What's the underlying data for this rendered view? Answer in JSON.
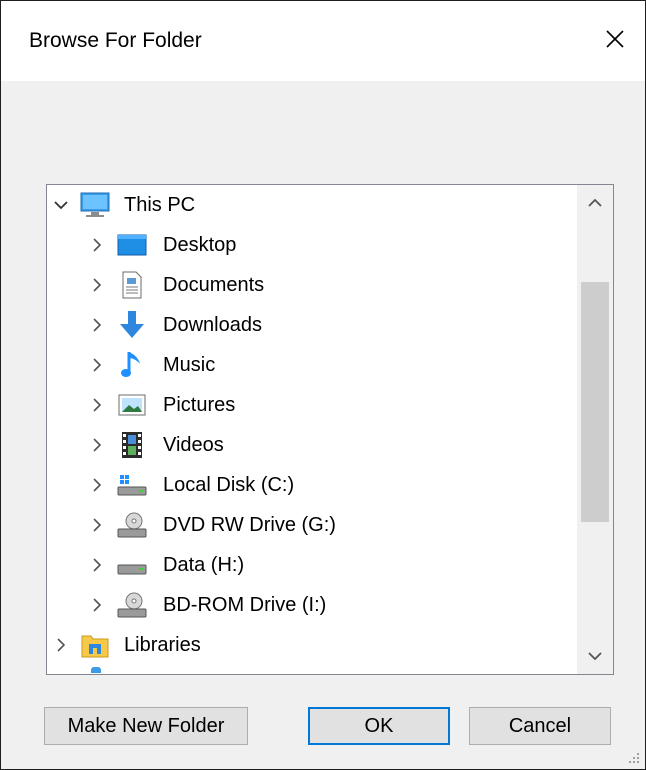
{
  "window": {
    "title": "Browse For Folder",
    "close_glyph": "✕"
  },
  "tree": {
    "items": [
      {
        "label": "This PC",
        "icon": "computer-icon",
        "expanded": true,
        "level": 0
      },
      {
        "label": "Desktop",
        "icon": "desktop-icon",
        "level": 1
      },
      {
        "label": "Documents",
        "icon": "documents-icon",
        "level": 1
      },
      {
        "label": "Downloads",
        "icon": "downloads-icon",
        "level": 1
      },
      {
        "label": "Music",
        "icon": "music-icon",
        "level": 1
      },
      {
        "label": "Pictures",
        "icon": "pictures-icon",
        "level": 1
      },
      {
        "label": "Videos",
        "icon": "videos-icon",
        "level": 1
      },
      {
        "label": "Local Disk (C:)",
        "icon": "local-disk-icon",
        "level": 1
      },
      {
        "label": "DVD RW Drive (G:)",
        "icon": "optical-drive-icon",
        "level": 1
      },
      {
        "label": "Data (H:)",
        "icon": "drive-icon",
        "level": 1
      },
      {
        "label": "BD-ROM Drive (I:)",
        "icon": "optical-drive-icon",
        "level": 1
      },
      {
        "label": "Libraries",
        "icon": "libraries-icon",
        "level": 0
      }
    ]
  },
  "buttons": {
    "make_new_folder": "Make New Folder",
    "ok": "OK",
    "cancel": "Cancel"
  },
  "colors": {
    "accent": "#0078d7",
    "window_bg": "#f0f0f0",
    "tree_border": "#828790"
  }
}
